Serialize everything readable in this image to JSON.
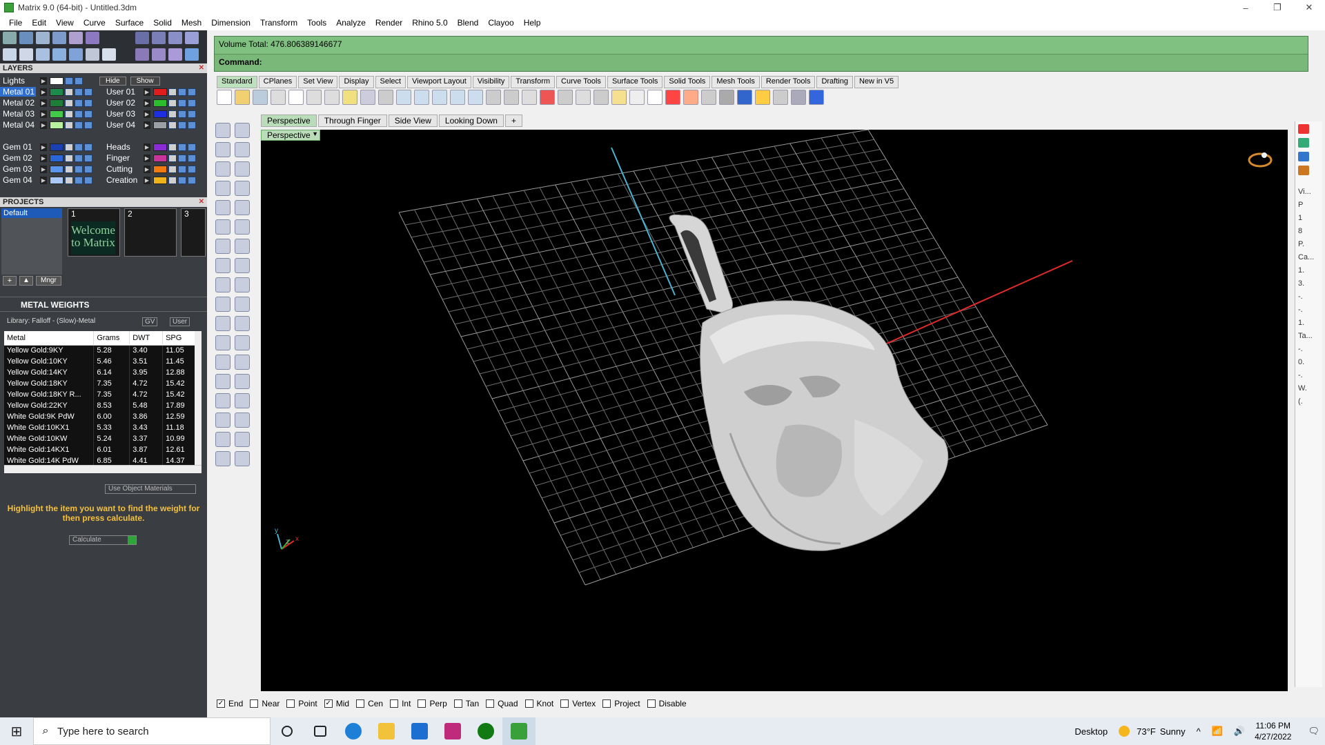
{
  "window": {
    "title": "Matrix 9.0 (64-bit) - Untitled.3dm",
    "minimize": "–",
    "restore": "❐",
    "close": "✕"
  },
  "menu": [
    "File",
    "Edit",
    "View",
    "Curve",
    "Surface",
    "Solid",
    "Mesh",
    "Dimension",
    "Transform",
    "Tools",
    "Analyze",
    "Render",
    "Rhino 5.0",
    "Blend",
    "Clayoo",
    "Help"
  ],
  "layers": {
    "title": "LAYERS",
    "lights_label": "Lights",
    "hide_label": "Hide",
    "show_label": "Show",
    "left": [
      {
        "name": "Metal 01",
        "color": "#1b8a4a",
        "selected": true
      },
      {
        "name": "Metal 02",
        "color": "#1f7d3a"
      },
      {
        "name": "Metal 03",
        "color": "#43c94a"
      },
      {
        "name": "Metal 04",
        "color": "#b6f2a0"
      },
      {
        "name": "Gem 01",
        "color": "#1a3fb0"
      },
      {
        "name": "Gem 02",
        "color": "#2b66d8"
      },
      {
        "name": "Gem 03",
        "color": "#5b95ec"
      },
      {
        "name": "Gem 04",
        "color": "#a9c8f7"
      }
    ],
    "right": [
      {
        "name": "User 01",
        "color": "#e01c1c"
      },
      {
        "name": "User 02",
        "color": "#2bbd2b"
      },
      {
        "name": "User 03",
        "color": "#1c2ee0"
      },
      {
        "name": "User 04",
        "color": "#9aa0a6"
      },
      {
        "name": "Heads",
        "color": "#8a2bd6"
      },
      {
        "name": "Finger",
        "color": "#c8349a"
      },
      {
        "name": "Cutting",
        "color": "#f07a10"
      },
      {
        "name": "Creation",
        "color": "#f0b21a"
      }
    ]
  },
  "projects": {
    "title": "PROJECTS",
    "items": [
      "Default"
    ],
    "slots": [
      "1",
      "2",
      "3"
    ],
    "welcome_text": "Welcome to Matrix",
    "manager_label": "Mngr"
  },
  "metal_weights": {
    "title": "METAL WEIGHTS",
    "library": "Library: Falloff - (Slow)-Metal",
    "gv_label": "GV",
    "user_label": "User",
    "columns": [
      "Metal",
      "Grams",
      "DWT",
      "SPG"
    ],
    "rows": [
      [
        "Yellow Gold:9KY",
        "5.28",
        "3.40",
        "11.05"
      ],
      [
        "Yellow Gold:10KY",
        "5.46",
        "3.51",
        "11.45"
      ],
      [
        "Yellow Gold:14KY",
        "6.14",
        "3.95",
        "12.88"
      ],
      [
        "Yellow Gold:18KY",
        "7.35",
        "4.72",
        "15.42"
      ],
      [
        "Yellow Gold:18KY R...",
        "7.35",
        "4.72",
        "15.42"
      ],
      [
        "Yellow Gold:22KY",
        "8.53",
        "5.48",
        "17.89"
      ],
      [
        "White Gold:9K PdW",
        "6.00",
        "3.86",
        "12.59"
      ],
      [
        "White Gold:10KX1",
        "5.33",
        "3.43",
        "11.18"
      ],
      [
        "White Gold:10KW",
        "5.24",
        "3.37",
        "10.99"
      ],
      [
        "White Gold:14KX1",
        "6.01",
        "3.87",
        "12.61"
      ],
      [
        "White Gold:14K PdW",
        "6.85",
        "4.41",
        "14.37"
      ]
    ],
    "use_object_materials": "Use Object Materials",
    "hint": "Highlight the item you want to find the weight for then press calculate.",
    "calculate_label": "Calculate"
  },
  "command": {
    "history": "Volume Total: 476.806389146677",
    "prompt": "Command:"
  },
  "toolbar_tabs": [
    "Standard",
    "CPlanes",
    "Set View",
    "Display",
    "Select",
    "Viewport Layout",
    "Visibility",
    "Transform",
    "Curve Tools",
    "Surface Tools",
    "Solid Tools",
    "Mesh Tools",
    "Render Tools",
    "Drafting",
    "New in V5"
  ],
  "viewport_tabs": [
    "Perspective",
    "Through Finger",
    "Side View",
    "Looking Down"
  ],
  "viewport_title": "Perspective",
  "axis_labels": {
    "x": "x",
    "y": "y",
    "z": "z"
  },
  "right_strip": [
    "Vi...",
    "P",
    "1",
    "8",
    "P.",
    "Ca...",
    "1.",
    "3.",
    "-.",
    "-.",
    "1.",
    "Ta...",
    "-.",
    "0.",
    "-.",
    "W.",
    "(."
  ],
  "osnap": [
    {
      "label": "End",
      "checked": true
    },
    {
      "label": "Near",
      "checked": false
    },
    {
      "label": "Point",
      "checked": false
    },
    {
      "label": "Mid",
      "checked": true
    },
    {
      "label": "Cen",
      "checked": false
    },
    {
      "label": "Int",
      "checked": false
    },
    {
      "label": "Perp",
      "checked": false
    },
    {
      "label": "Tan",
      "checked": false
    },
    {
      "label": "Quad",
      "checked": false
    },
    {
      "label": "Knot",
      "checked": false
    },
    {
      "label": "Vertex",
      "checked": false
    },
    {
      "label": "Project",
      "checked": false
    },
    {
      "label": "Disable",
      "checked": false
    }
  ],
  "taskbar": {
    "search_placeholder": "Type here to search",
    "desktop_label": "Desktop",
    "weather_temp": "73°F",
    "weather_text": "Sunny",
    "time": "11:06 PM",
    "date": "4/27/2022"
  }
}
